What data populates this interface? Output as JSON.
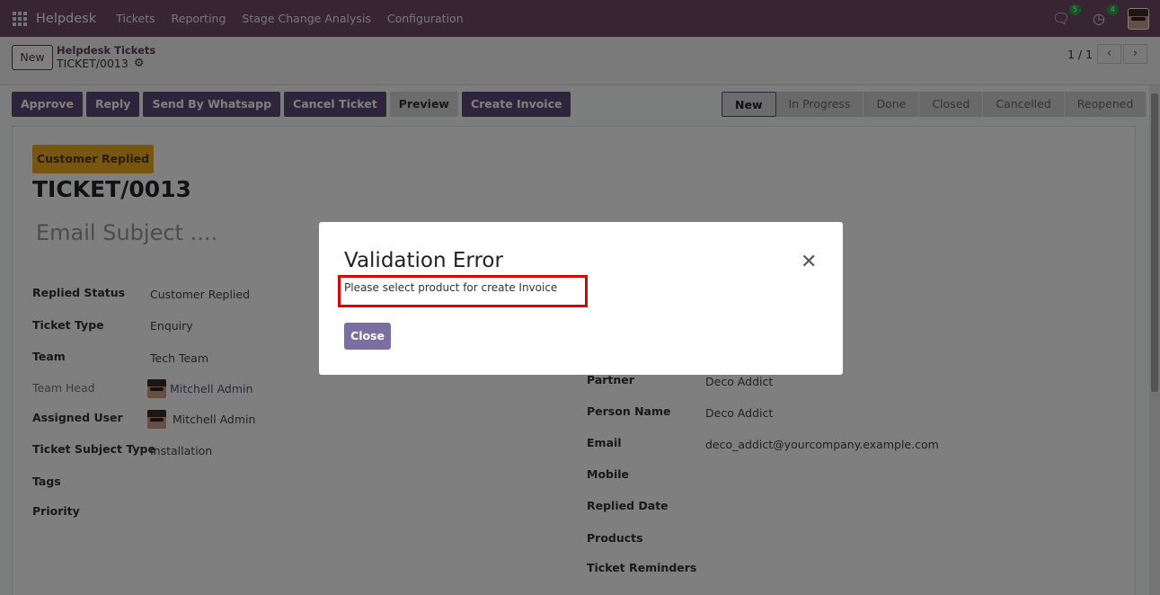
{
  "navbar": {
    "brand": "Helpdesk",
    "menu": [
      "Tickets",
      "Reporting",
      "Stage Change Analysis",
      "Configuration"
    ],
    "messages_count": "5",
    "activities_count": "4"
  },
  "control": {
    "new_label": "New",
    "breadcrumb_parent": "Helpdesk Tickets",
    "breadcrumb_current": "TICKET/0013",
    "pager": "1 / 1"
  },
  "actions": [
    "Approve",
    "Reply",
    "Send By Whatsapp",
    "Cancel Ticket",
    "Preview",
    "Create Invoice"
  ],
  "stages": {
    "active": "New",
    "others": [
      "In Progress",
      "Done",
      "Closed",
      "Cancelled",
      "Reopened"
    ]
  },
  "form": {
    "ribbon": "Customer Replied",
    "ticket_number": "TICKET/0013",
    "email_subject_placeholder": "Email Subject ....",
    "left_fields": [
      {
        "label": "Replied Status",
        "value": "Customer Replied"
      },
      {
        "label": "Ticket Type",
        "value": "Enquiry"
      },
      {
        "label": "Team",
        "value": "Tech Team"
      },
      {
        "label": "Team Head",
        "value": "Mitchell Admin"
      },
      {
        "label": "Assigned User",
        "value": "Mitchell Admin"
      },
      {
        "label": "Ticket Subject Type",
        "value": "Installation"
      },
      {
        "label": "Tags",
        "value": ""
      },
      {
        "label": "Priority",
        "value": ""
      }
    ],
    "right_fields": [
      {
        "label": "Partner",
        "value": "Deco Addict"
      },
      {
        "label": "Person Name",
        "value": "Deco Addict"
      },
      {
        "label": "Email",
        "value": "deco_addict@yourcompany.example.com"
      },
      {
        "label": "Mobile",
        "value": ""
      },
      {
        "label": "Replied Date",
        "value": ""
      },
      {
        "label": "Products",
        "value": ""
      },
      {
        "label": "Ticket Reminders",
        "value": ""
      }
    ]
  },
  "modal": {
    "title": "Validation Error",
    "message": "Please select product for create Invoice",
    "close_label": "Close"
  },
  "colors": {
    "navbar": "#714b67",
    "primary": "#5c4a7a",
    "ribbon": "#f0ad1e",
    "highlight": "#e00000"
  }
}
